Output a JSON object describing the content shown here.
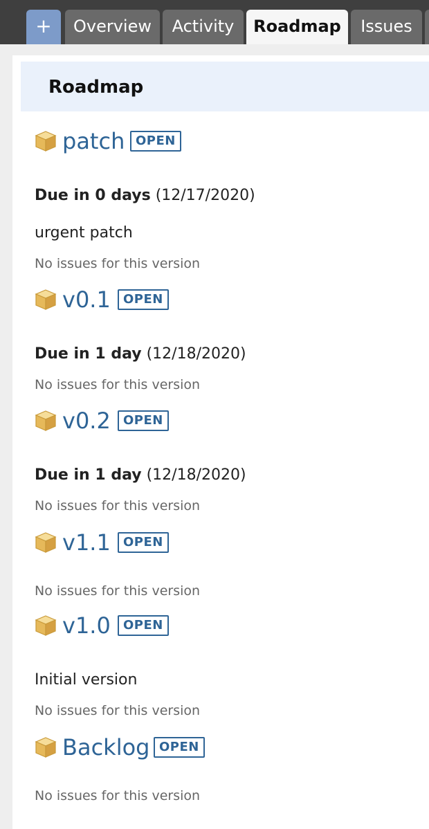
{
  "tabs": [
    {
      "label": "+",
      "selected": false
    },
    {
      "label": "Overview",
      "selected": false
    },
    {
      "label": "Activity",
      "selected": false
    },
    {
      "label": "Roadmap",
      "selected": true
    },
    {
      "label": "Issues",
      "selected": false
    }
  ],
  "page_title": "Roadmap",
  "versions": [
    {
      "name": "patch",
      "status": "OPEN",
      "due_strong": "Due in 0 days",
      "due_date": "(12/17/2020)",
      "description": "urgent patch",
      "issues_text": "No issues for this version"
    },
    {
      "name": "v0.1",
      "status": "OPEN",
      "due_strong": "Due in 1 day",
      "due_date": "(12/18/2020)",
      "description": "",
      "issues_text": "No issues for this version"
    },
    {
      "name": "v0.2",
      "status": "OPEN",
      "due_strong": "Due in 1 day",
      "due_date": "(12/18/2020)",
      "description": "",
      "issues_text": "No issues for this version"
    },
    {
      "name": "v1.1",
      "status": "OPEN",
      "due_strong": "",
      "due_date": "",
      "description": "",
      "issues_text": "No issues for this version"
    },
    {
      "name": "v1.0",
      "status": "OPEN",
      "due_strong": "",
      "due_date": "",
      "description": "Initial version",
      "issues_text": "No issues for this version"
    },
    {
      "name": "Backlog",
      "status": "OPEN",
      "due_strong": "",
      "due_date": "",
      "description": "",
      "issues_text": "No issues for this version"
    }
  ],
  "icons": {
    "version": "package-icon"
  },
  "colors": {
    "topbar": "#3f3f3f",
    "tab": "#6a6a6a",
    "tab_plus": "#7d9bc9",
    "tab_selected": "#f6f6f6",
    "link": "#2e6496",
    "header_bg": "#eaf1fb"
  }
}
